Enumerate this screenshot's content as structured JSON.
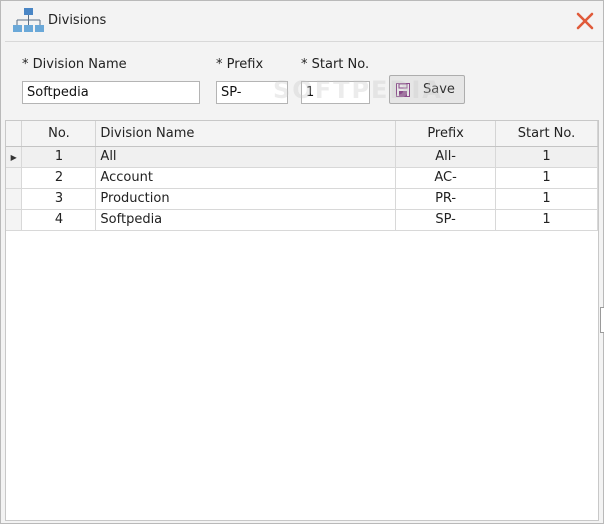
{
  "window": {
    "title": "Divisions"
  },
  "form": {
    "division_name_label": "* Division Name",
    "division_name_value": "Softpedia",
    "prefix_label": "* Prefix",
    "prefix_value": "SP-",
    "start_no_label": "* Start No.",
    "start_no_value": "1",
    "save_label": "Save"
  },
  "watermark": "SOFTPEDIA",
  "grid": {
    "columns": [
      "No.",
      "Division Name",
      "Prefix",
      "Start No."
    ],
    "rows": [
      {
        "no": "1",
        "name": "All",
        "prefix": "All-",
        "start": "1",
        "selected": true
      },
      {
        "no": "2",
        "name": "Account",
        "prefix": "AC-",
        "start": "1",
        "selected": false
      },
      {
        "no": "3",
        "name": "Production",
        "prefix": "PR-",
        "start": "1",
        "selected": false
      },
      {
        "no": "4",
        "name": "Softpedia",
        "prefix": "SP-",
        "start": "1",
        "selected": false
      }
    ]
  },
  "colors": {
    "close": "#e05a3a",
    "org_icon": "#4a86c5",
    "org_icon_child": "#6aa8d8"
  },
  "icons": {
    "app": "org-chart-icon",
    "close": "close-icon",
    "save": "floppy-disk-icon",
    "row_pointer": "row-pointer-icon"
  }
}
